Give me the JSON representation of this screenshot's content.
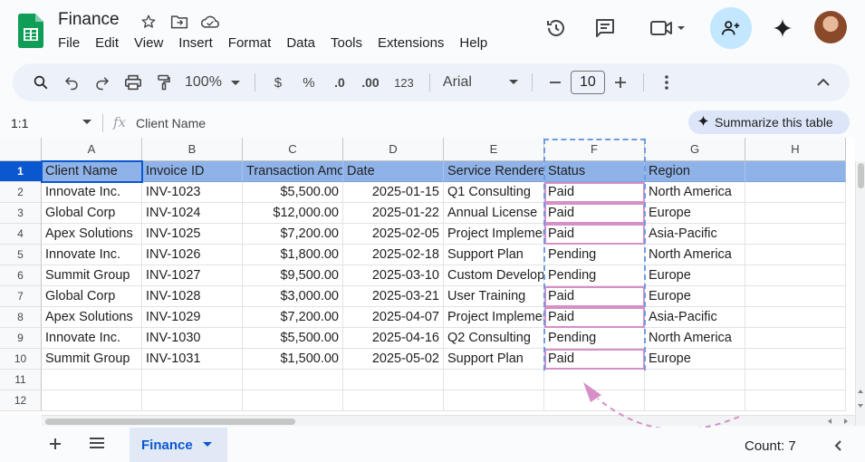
{
  "app": {
    "title": "Finance",
    "menu": [
      "File",
      "Edit",
      "View",
      "Insert",
      "Format",
      "Data",
      "Tools",
      "Extensions",
      "Help"
    ]
  },
  "toolbar": {
    "zoom": "100%",
    "currency": "$",
    "percent": "%",
    "dec_decrease": ".0",
    "dec_increase": ".00",
    "number_format": "123",
    "font": "Arial",
    "font_size": "10"
  },
  "formula_bar": {
    "cell_ref": "1:1",
    "content": "Client Name",
    "summarize_label": "Summarize this table"
  },
  "columns": [
    "A",
    "B",
    "C",
    "D",
    "E",
    "F",
    "G",
    "H"
  ],
  "rows": [
    {
      "n": "1",
      "cells": [
        "Client Name",
        "Invoice ID",
        "Transaction Amount",
        "Date",
        "Service Rendered",
        "Status",
        "Region",
        ""
      ]
    },
    {
      "n": "2",
      "cells": [
        "Innovate Inc.",
        "INV-1023",
        "$5,500.00",
        "2025-01-15",
        "Q1 Consulting",
        "Paid",
        "North America",
        ""
      ]
    },
    {
      "n": "3",
      "cells": [
        "Global Corp",
        "INV-1024",
        "$12,000.00",
        "2025-01-22",
        "Annual License",
        "Paid",
        "Europe",
        ""
      ]
    },
    {
      "n": "4",
      "cells": [
        "Apex Solutions",
        "INV-1025",
        "$7,200.00",
        "2025-02-05",
        "Project Implementation",
        "Paid",
        "Asia-Pacific",
        ""
      ]
    },
    {
      "n": "5",
      "cells": [
        "Innovate Inc.",
        "INV-1026",
        "$1,800.00",
        "2025-02-18",
        "Support Plan",
        "Pending",
        "North America",
        ""
      ]
    },
    {
      "n": "6",
      "cells": [
        "Summit Group",
        "INV-1027",
        "$9,500.00",
        "2025-03-10",
        "Custom Development",
        "Pending",
        "Europe",
        ""
      ]
    },
    {
      "n": "7",
      "cells": [
        "Global Corp",
        "INV-1028",
        "$3,000.00",
        "2025-03-21",
        "User Training",
        "Paid",
        "Europe",
        ""
      ]
    },
    {
      "n": "8",
      "cells": [
        "Apex Solutions",
        "INV-1029",
        "$7,200.00",
        "2025-04-07",
        "Project Implementation",
        "Paid",
        "Asia-Pacific",
        ""
      ]
    },
    {
      "n": "9",
      "cells": [
        "Innovate Inc.",
        "INV-1030",
        "$5,500.00",
        "2025-04-16",
        "Q2 Consulting",
        "Pending",
        "North America",
        ""
      ]
    },
    {
      "n": "10",
      "cells": [
        "Summit Group",
        "INV-1031",
        "$1,500.00",
        "2025-05-02",
        "Support Plan",
        "Paid",
        "Europe",
        ""
      ]
    },
    {
      "n": "11",
      "cells": [
        "",
        "",
        "",
        "",
        "",
        "",
        "",
        ""
      ]
    },
    {
      "n": "12",
      "cells": [
        "",
        "",
        "",
        "",
        "",
        "",
        "",
        ""
      ]
    }
  ],
  "bottom": {
    "sheet_name": "Finance",
    "count": "Count: 7"
  },
  "colors": {
    "header_row": "#8fb3e8",
    "accent": "#0b57d0",
    "status_highlight": "#d68fc7"
  }
}
